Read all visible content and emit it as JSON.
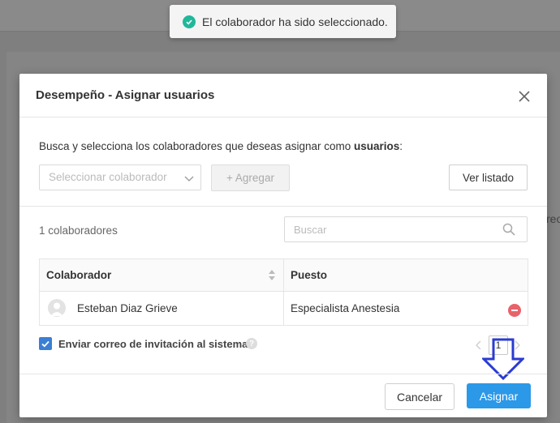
{
  "toast": {
    "message": "El colaborador ha sido seleccionado."
  },
  "background": {
    "edge_text": "reo"
  },
  "modal": {
    "title": "Desempeño - Asignar usuarios",
    "instructions_prefix": "Busca y selecciona los colaboradores que deseas asignar como ",
    "instructions_bold": "usuarios",
    "instructions_suffix": ":",
    "select_placeholder": "Seleccionar colaborador",
    "add_button": "+ Agregar",
    "view_list_button": "Ver listado",
    "count_label": "1 colaboradores",
    "search_placeholder": "Buscar",
    "table": {
      "headers": [
        "Colaborador",
        "Puesto"
      ],
      "rows": [
        {
          "name": "Esteban Diaz Grieve",
          "position": "Especialista Anestesia"
        }
      ]
    },
    "invite_checkbox": {
      "label": "Enviar correo de invitación al sistema.",
      "checked": true
    },
    "pagination": {
      "current": "1"
    },
    "cancel_button": "Cancelar",
    "assign_button": "Asignar"
  },
  "colors": {
    "accent": "#2c98e8",
    "success": "#1fb89a",
    "danger": "#e8626a",
    "annotation_arrow": "#2b3bd1"
  }
}
